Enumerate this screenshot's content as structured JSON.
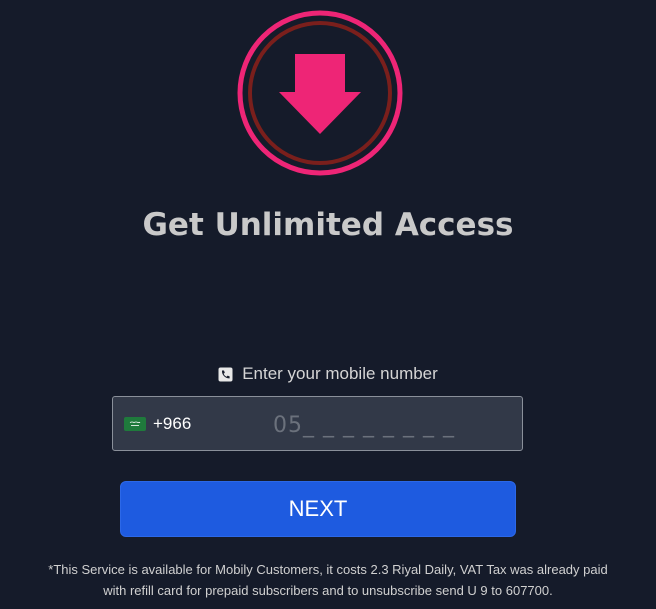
{
  "header": {
    "icon": "download-arrow-icon",
    "title": "Get Unlimited Access"
  },
  "form": {
    "label": "Enter your mobile number",
    "label_icon": "phone-icon",
    "flag_icon": "saudi-flag-icon",
    "country_code": "+966",
    "phone_placeholder": "05_ _ _ _ _ _ _ _",
    "phone_value": "",
    "next_label": "NEXT"
  },
  "footer": {
    "line1": "*This Service is available for Mobily Customers, it costs 2.3 Riyal Daily, VAT Tax was already paid",
    "line2": "with refill card for prepaid subscribers and to unsubscribe send U 9 to 607700."
  },
  "colors": {
    "background": "#151b2a",
    "accent_pink": "#ee2576",
    "ring_dark_red": "#7a1f1c",
    "button_blue": "#1e5be0"
  }
}
